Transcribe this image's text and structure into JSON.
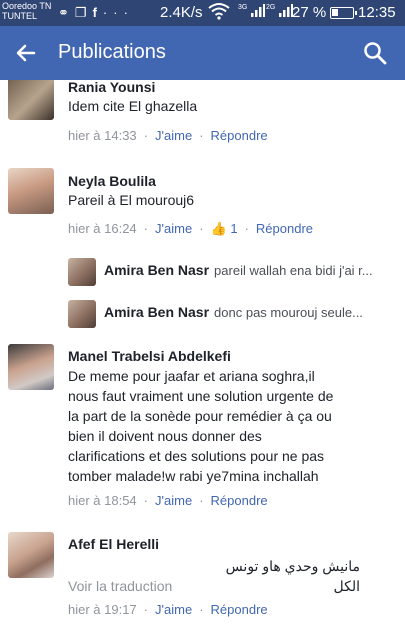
{
  "status": {
    "carrier_line1": "Ooredoo TN",
    "carrier_line2": "TUNTEL",
    "speed": "2.4K/s",
    "net1": "3G",
    "net2": "2G",
    "battery": "27 %",
    "time": "12:35"
  },
  "appbar": {
    "title": "Publications"
  },
  "labels": {
    "like": "J'aime",
    "reply": "Répondre",
    "translate": "Voir la traduction"
  },
  "comments": [
    {
      "name": "Rania Younsi",
      "text": "Idem cite El ghazella",
      "time": "hier à 14:33"
    },
    {
      "name": "Neyla Boulila",
      "text": "Pareil à El mourouj6",
      "time": "hier à 16:24",
      "likes": "1",
      "replies": [
        {
          "name": "Amira Ben Nasr",
          "text": "pareil wallah ena bidi j'ai r..."
        },
        {
          "name": "Amira Ben Nasr",
          "text": "donc pas mourouj seule..."
        }
      ]
    },
    {
      "name": "Manel Trabelsi Abdelkefi",
      "text_lines": [
        "De meme pour jaafar et ariana soghra,il",
        "nous faut vraiment une solution urgente de",
        "la part de la sonède pour remédier à ça ou",
        "bien il doivent nous donner des",
        "clarifications et des solutions pour ne pas",
        "tomber malade!w rabi ye7mina inchallah"
      ],
      "time": "hier à 18:54"
    },
    {
      "name": "Afef El Herelli",
      "text": "مانيش وحدي هاو تونس الكل",
      "time": "hier à 19:17"
    }
  ],
  "colors": {
    "appbar": "#4267b2",
    "statusbar": "#2f4574",
    "link": "#4267b2",
    "meta": "#90949c"
  }
}
